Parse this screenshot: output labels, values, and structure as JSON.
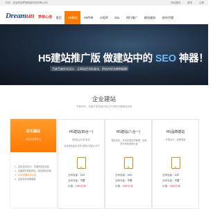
{
  "topbar": {
    "welcome": "你好，欢迎来到梦想网络科技有限公司！",
    "links": [
      "网站建设",
      "|",
      "登录",
      "|",
      "注册"
    ]
  },
  "header": {
    "logo_en_a": "Dream",
    "logo_en_b": "un",
    "logo_cn": "梦想心连",
    "nav": [
      {
        "label": "首页",
        "active": false
      },
      {
        "label": "H5建站",
        "active": true
      },
      {
        "label": "H5传单",
        "active": false
      },
      {
        "label": "小程序",
        "active": false
      },
      {
        "label": "SSL",
        "active": false
      },
      {
        "label": "同行推广",
        "active": false
      },
      {
        "label": "建站服务",
        "active": false
      },
      {
        "label": "合作代理",
        "active": false
      }
    ]
  },
  "banner": {
    "headline_a": "H5建站推广版 做建站中的",
    "headline_seo": "SEO",
    "headline_b": "神器！",
    "subline_a": "百度百度优化设计，让网站优化标准化，把站内优化做到极致！",
    "subline_em": ""
  },
  "section": {
    "title": "企业建站",
    "desc": "不使代码，也能开发体验出真正产品的完美建站系统"
  },
  "cards": [
    {
      "featured": true,
      "title": "优化建站",
      "sub": "适合正品牌企业",
      "features": [
        "1、安全全站SEO、关键词排名优化",
        "2、全面提升网站排名，增加网站流量",
        "3、2000字数站内公告",
        "4、全站优化设置模板"
      ],
      "highlight_index": 2
    },
    {
      "featured": false,
      "title": "H5建站(四合一)",
      "sub": "网站站点4合1标记",
      "desc": "包含网站建设手机+微信小程序+APP",
      "specs": [
        {
          "k": "空间容量：",
          "v": "10G"
        },
        {
          "k": "空间流量：",
          "v": "不限"
        },
        {
          "k": "价格：",
          "v": "1980元/年",
          "price": true
        }
      ]
    },
    {
      "featured": false,
      "title": "H5建站(八合一)",
      "sub": "",
      "desc": "整站优化，支持多端协同管理，全面提升网络营销价值",
      "specs": [
        {
          "k": "空间容量：",
          "v": "10G"
        },
        {
          "k": "空间流量：",
          "v": "不限"
        },
        {
          "k": "价格：",
          "v": "3980元/年",
          "price": true
        }
      ]
    },
    {
      "featured": false,
      "title": "H5品牌建站",
      "sub": "专属设计，品牌官网",
      "desc": "",
      "specs": [
        {
          "k": "空间容量：",
          "v": "10G"
        },
        {
          "k": "空间流量：",
          "v": "不限"
        },
        {
          "k": "价格：",
          "v": "5980元/年",
          "price": true
        }
      ]
    }
  ]
}
